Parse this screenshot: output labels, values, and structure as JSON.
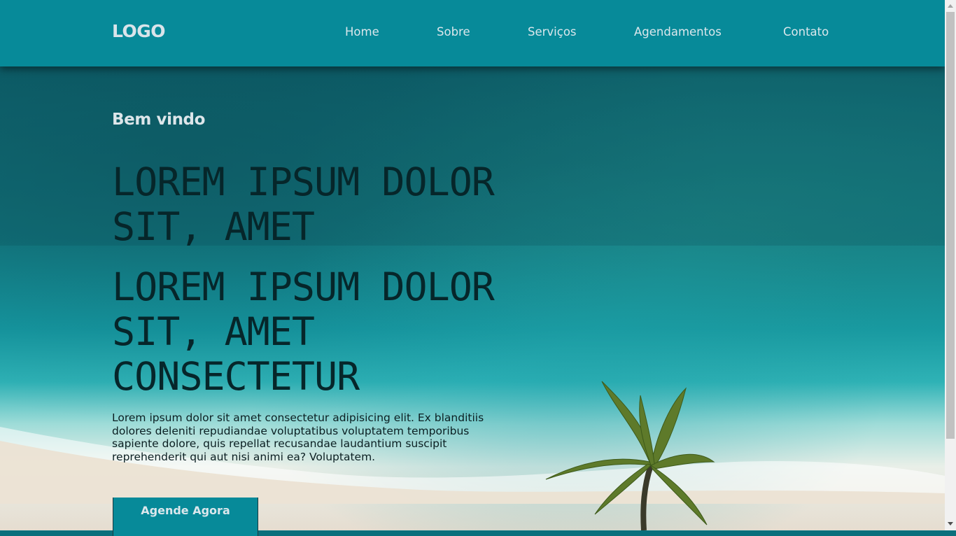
{
  "header": {
    "logo": "LOGO",
    "nav": [
      {
        "label": "Home"
      },
      {
        "label": "Sobre"
      },
      {
        "label": "Serviços"
      },
      {
        "label": "Agendamentos"
      },
      {
        "label": "Contato"
      }
    ],
    "background_color": "#078a99"
  },
  "hero": {
    "welcome": "Bem vindo",
    "headline_1": {
      "line_1": "LOREM IPSUM DOLOR",
      "line_2": "SIT, AMET"
    },
    "headline_2": {
      "line_1": "LOREM IPSUM DOLOR",
      "line_2": "SIT, AMET",
      "line_3": "CONSECTETUR"
    },
    "body": "Lorem ipsum dolor sit amet consectetur adipisicing elit. Ex blanditiis dolores deleniti repudiandae voluptatibus voluptatem temporibus sapiente dolore, quis repellat recusandae laudantium suscipit reprehenderit qui aut nisi animi ea? Voluptatem.",
    "cta_label": "Agende Agora",
    "background_image": "aerial-beach-palm-tree"
  },
  "colors": {
    "accent": "#078a99",
    "headline": "#06262a"
  }
}
